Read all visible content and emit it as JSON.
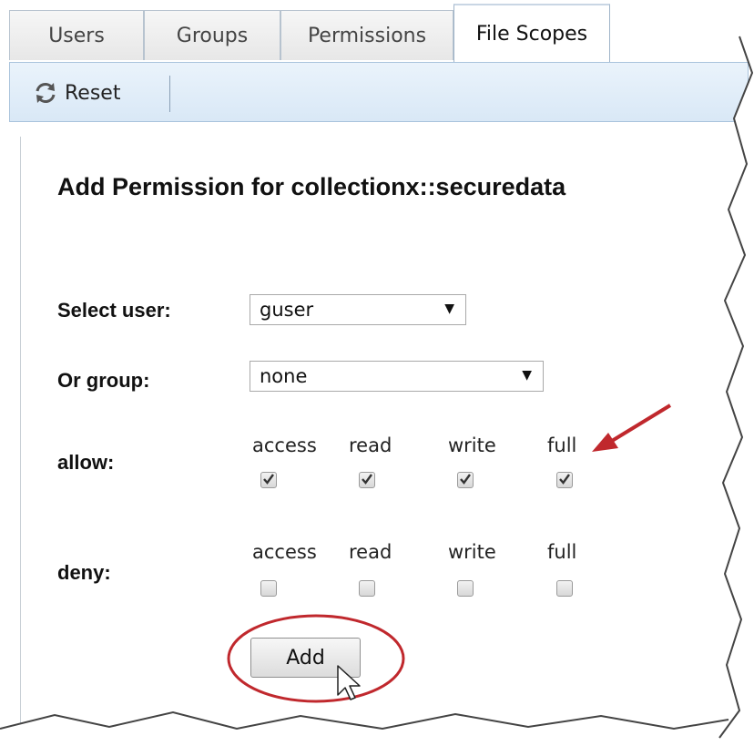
{
  "tabs": [
    {
      "label": "Users",
      "active": false
    },
    {
      "label": "Groups",
      "active": false
    },
    {
      "label": "Permissions",
      "active": false
    },
    {
      "label": "File Scopes",
      "active": true
    }
  ],
  "toolbar": {
    "reset_label": "Reset",
    "reset_icon": "refresh-icon"
  },
  "form": {
    "heading": "Add Permission for collectionx::securedata",
    "user_label": "Select user:",
    "user_value": "guser",
    "group_label": "Or group:",
    "group_value": "none",
    "allow_label": "allow:",
    "deny_label": "deny:",
    "permission_names": [
      "access",
      "read",
      "write",
      "full"
    ],
    "allow_checked": [
      true,
      true,
      true,
      true
    ],
    "deny_checked": [
      false,
      false,
      false,
      false
    ],
    "add_label": "Add"
  },
  "annotations": {
    "arrow_color": "#c0282d",
    "circle_color": "#c0282d"
  }
}
